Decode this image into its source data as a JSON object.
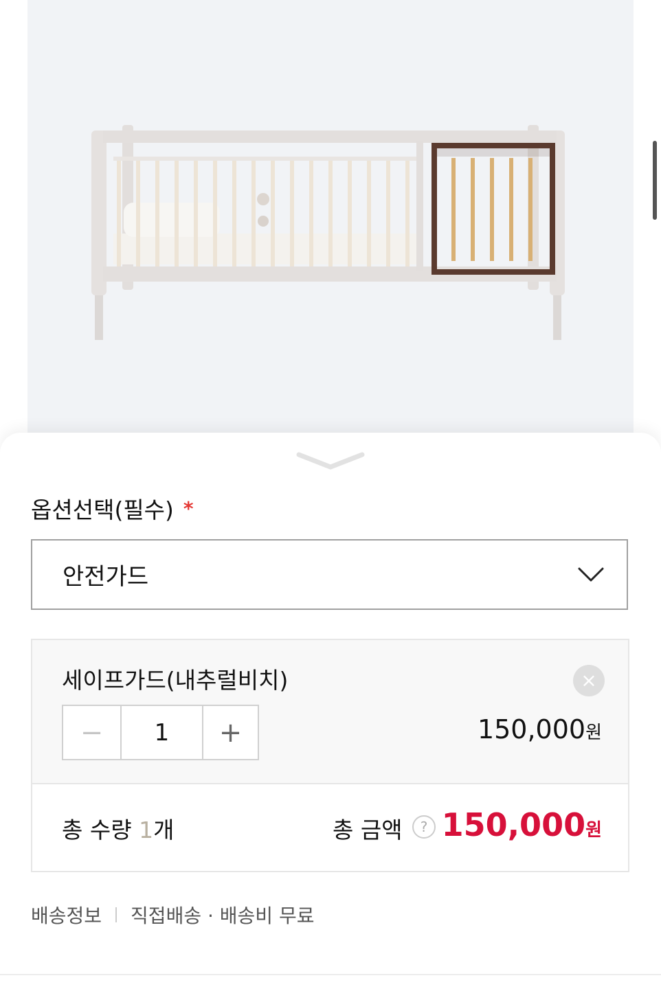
{
  "option_section": {
    "label": "옵션선택(필수)",
    "required_mark": "*",
    "selected_value": "안전가드"
  },
  "selected_item": {
    "name": "세이프가드(내추럴비치)",
    "remove_icon": "×",
    "quantity": "1",
    "minus_label": "−",
    "plus_label": "+",
    "price": "150,000",
    "currency": "원"
  },
  "totals": {
    "qty_label": "총 수량",
    "qty_value": "1",
    "qty_unit": "개",
    "amount_label": "총 금액",
    "help_icon": "?",
    "amount_value": "150,000",
    "currency": "원"
  },
  "shipping": {
    "label": "배송정보",
    "detail": "직접배송 · 배송비 무료"
  },
  "colors": {
    "accent_price": "#d7103a",
    "required": "#e53935"
  }
}
